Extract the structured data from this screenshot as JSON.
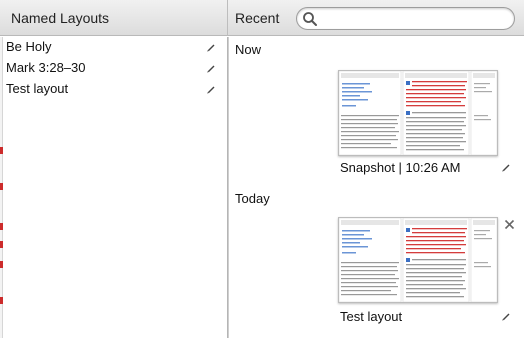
{
  "header": {
    "named_layouts_title": "Named Layouts",
    "recent_title": "Recent",
    "search": {
      "value": "",
      "placeholder": ""
    }
  },
  "layouts": [
    {
      "label": "Be Holy"
    },
    {
      "label": "Mark 3:28–30"
    },
    {
      "label": "Test layout"
    }
  ],
  "recent": {
    "groups": [
      {
        "heading": "Now",
        "items": [
          {
            "label": "Snapshot | 10:26 AM"
          }
        ]
      },
      {
        "heading": "Today",
        "items": [
          {
            "label": "Test layout"
          }
        ]
      }
    ]
  },
  "colors": {
    "header_bg": "#e2e2e2",
    "accent_blue": "#3a6fc4",
    "accent_red": "#cc2b2b"
  }
}
